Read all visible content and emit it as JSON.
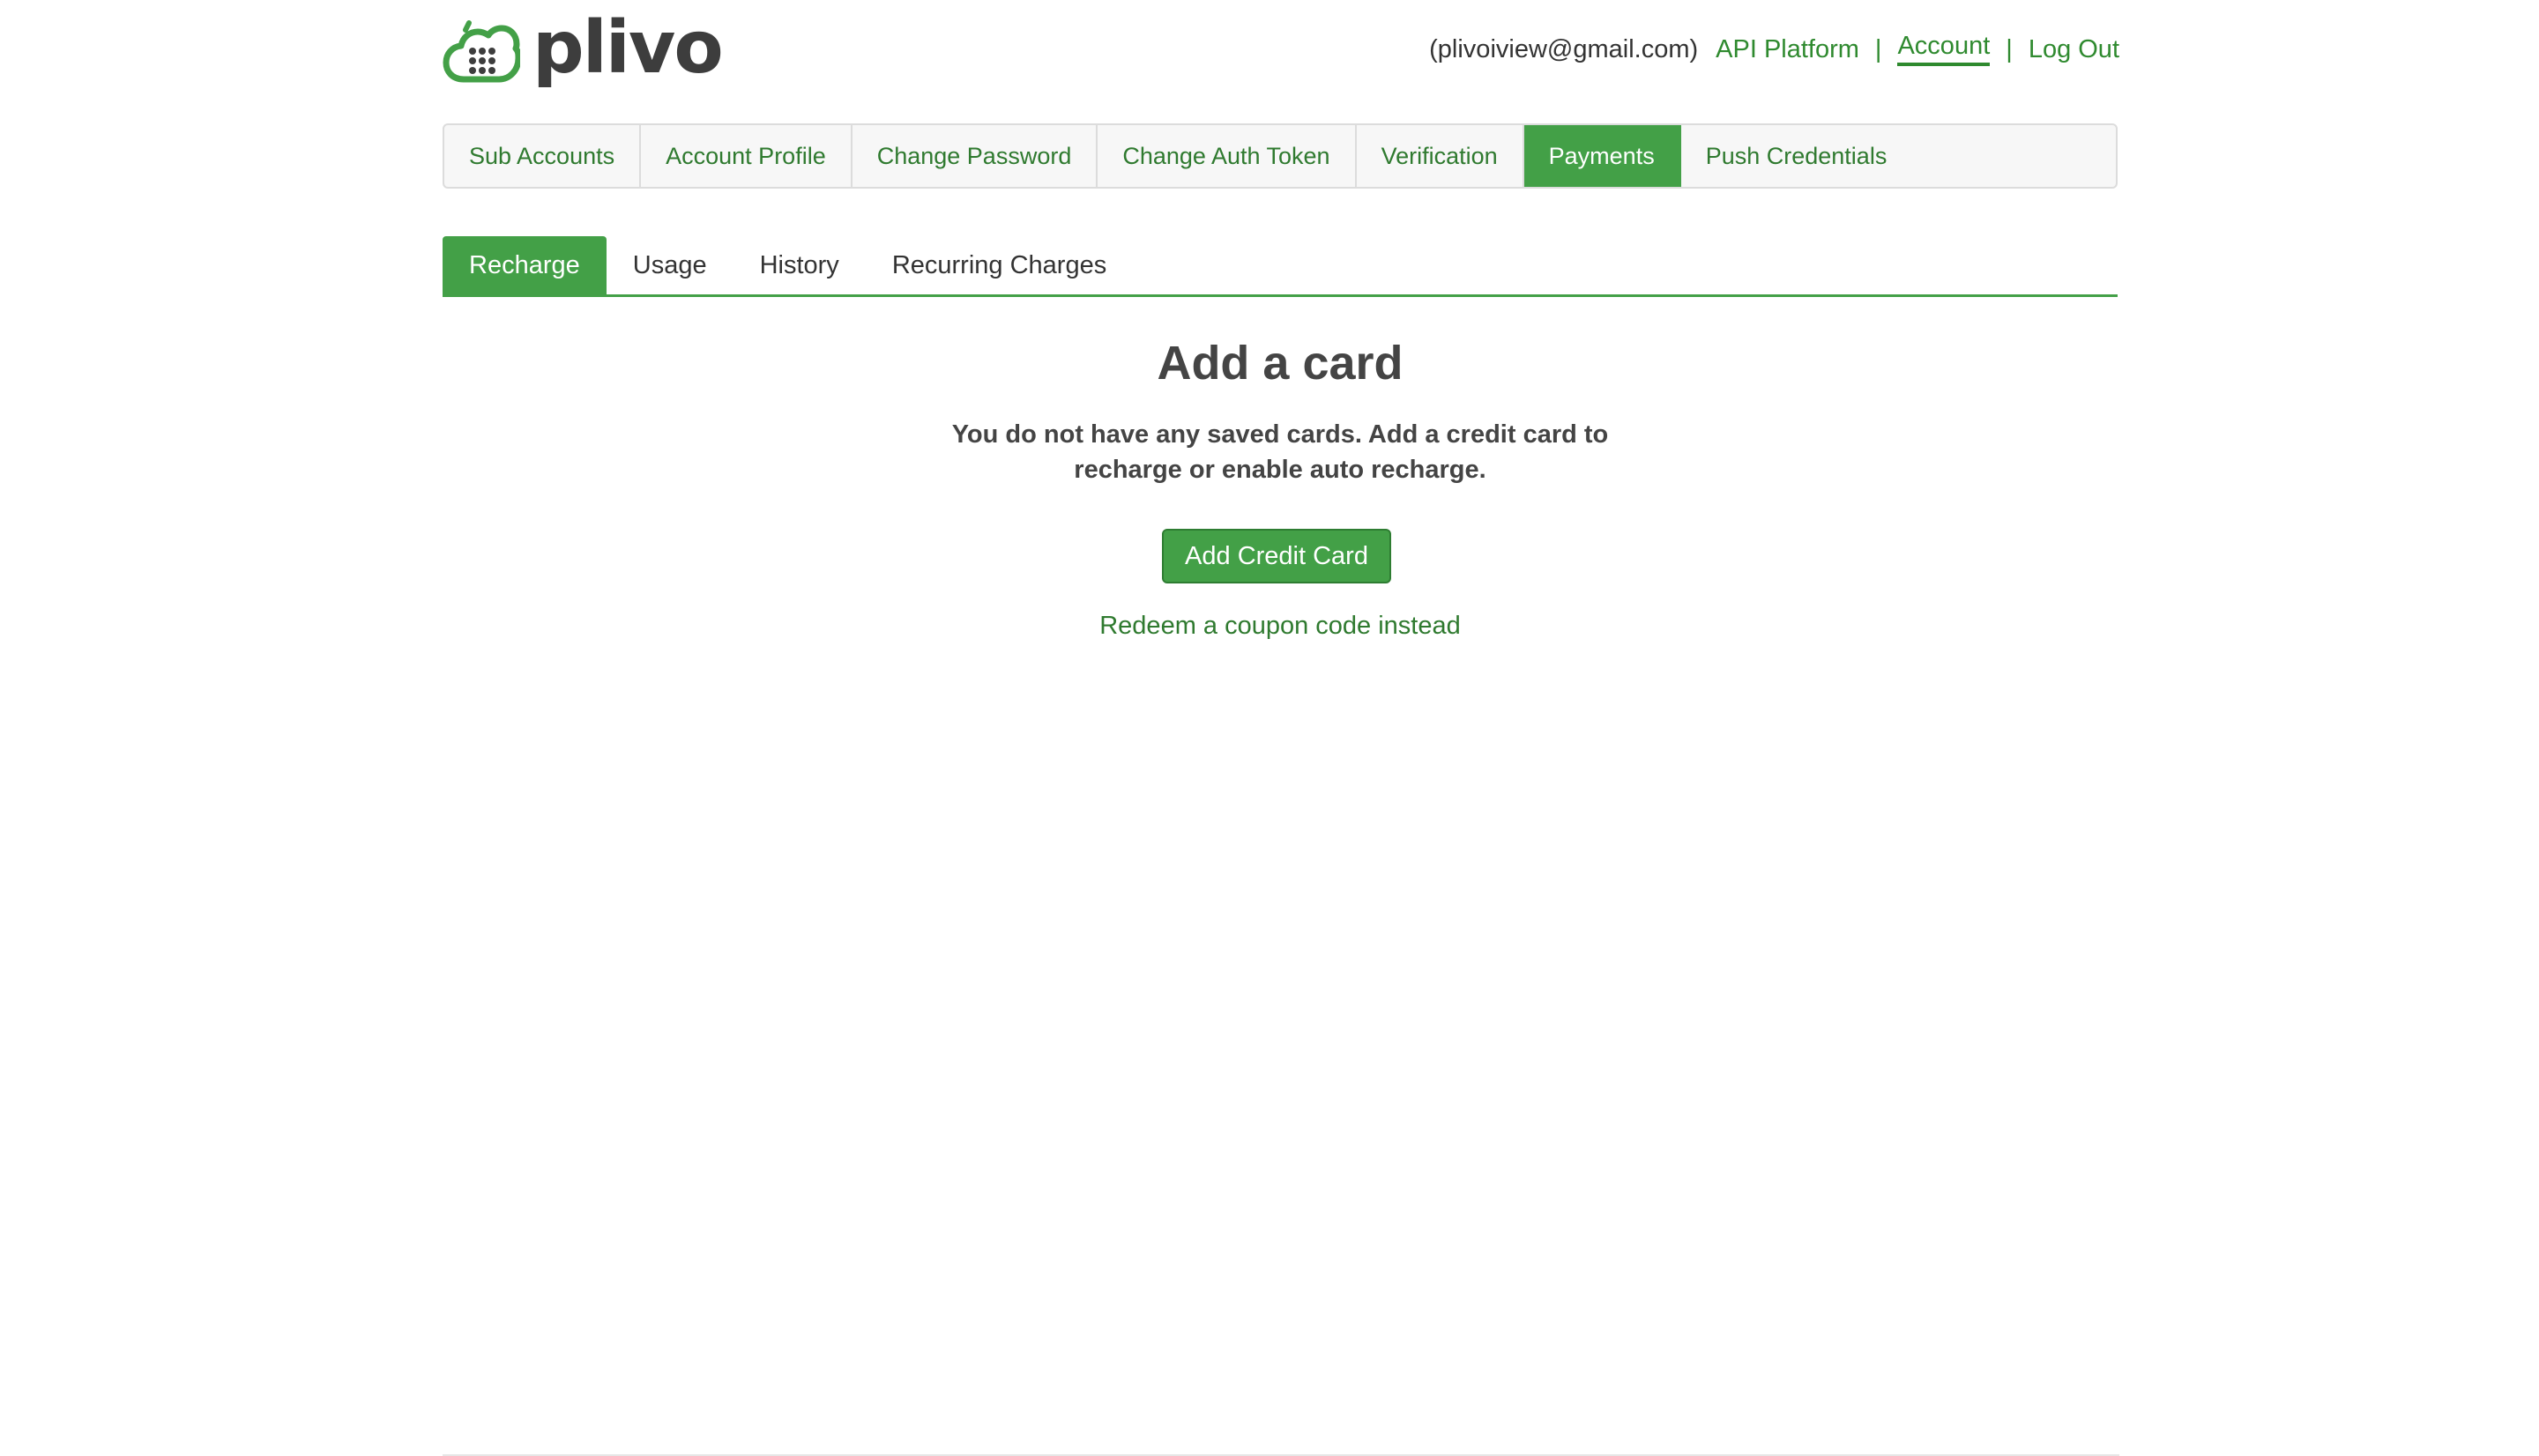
{
  "brand": {
    "name": "plivo",
    "accent": "#43a047",
    "link": "#2f7a2f"
  },
  "header": {
    "email": "(plivoiview@gmail.com)",
    "links": [
      {
        "label": "API Platform"
      },
      {
        "label": "Account",
        "active": true
      },
      {
        "label": "Log Out"
      }
    ],
    "separator": "|"
  },
  "main_nav": {
    "tabs": [
      {
        "label": "Sub Accounts"
      },
      {
        "label": "Account Profile"
      },
      {
        "label": "Change Password"
      },
      {
        "label": "Change Auth Token"
      },
      {
        "label": "Verification"
      },
      {
        "label": "Payments",
        "active": true
      },
      {
        "label": "Push Credentials"
      }
    ]
  },
  "sub_nav": {
    "tabs": [
      {
        "label": "Recharge",
        "active": true
      },
      {
        "label": "Usage"
      },
      {
        "label": "History"
      },
      {
        "label": "Recurring Charges"
      }
    ]
  },
  "content": {
    "title": "Add a card",
    "message": "You do not have any saved cards. Add a credit card to recharge or enable auto recharge.",
    "add_button": "Add Credit Card",
    "coupon_link": "Redeem a coupon code instead"
  },
  "icons": {
    "logo": "plivo-cloud-icon"
  }
}
